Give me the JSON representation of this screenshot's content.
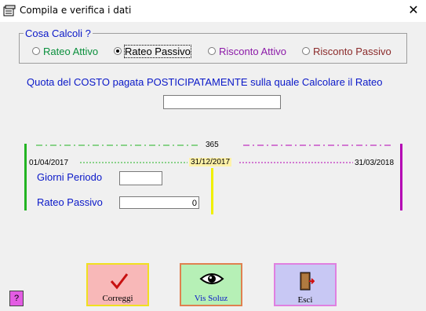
{
  "window": {
    "title": "Compila e verifica i dati",
    "close_glyph": "✕"
  },
  "group": {
    "label": "Cosa Calcoli ?",
    "options": [
      {
        "label": "Rateo Attivo",
        "selected": false,
        "color": "#0a8f3c"
      },
      {
        "label": "Rateo Passivo",
        "selected": true,
        "color": "#000000"
      },
      {
        "label": "Risconto Attivo",
        "selected": false,
        "color": "#8c1aa8"
      },
      {
        "label": "Risconto Passivo",
        "selected": false,
        "color": "#8b2a2a"
      }
    ]
  },
  "quota": {
    "label": "Quota del COSTO pagata POSTICIPATAMENTE sulla quale Calcolare il Rateo",
    "value": ""
  },
  "timeline": {
    "days_total": "365",
    "start_date": "01/04/2017",
    "mid_date": "31/12/2017",
    "end_date": "31/03/2018"
  },
  "giorni": {
    "label": "Giorni Periodo",
    "value": ""
  },
  "rateo": {
    "label": "Rateo Passivo",
    "value": "0"
  },
  "buttons": {
    "correggi": "Correggi",
    "vis_soluz": "Vis Soluz",
    "esci": "Esci",
    "help": "?"
  },
  "colors": {
    "green": "#22b422",
    "purple": "#b400b4",
    "yellow": "#f0f000",
    "blue": "#0a18c8"
  }
}
